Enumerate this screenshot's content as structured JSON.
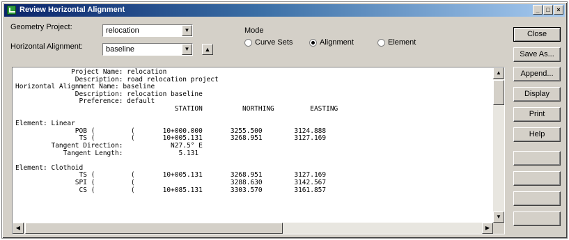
{
  "window": {
    "title": "Review Horizontal Alignment",
    "controls": {
      "minimize": "_",
      "maximize": "□",
      "close": "×"
    }
  },
  "form": {
    "geometry_project_label": "Geometry Project:",
    "geometry_project_value": "relocation",
    "horizontal_alignment_label": "Horizontal Alignment:",
    "horizontal_alignment_value": "baseline",
    "mode_label": "Mode",
    "mode_options": [
      {
        "label": "Curve Sets",
        "selected": false
      },
      {
        "label": "Alignment",
        "selected": true
      },
      {
        "label": "Element",
        "selected": false
      }
    ]
  },
  "report": {
    "lines": [
      "              Project Name: relocation",
      "               Description: road relocation project",
      "Horizontal Alignment Name: baseline",
      "               Description: relocation baseline",
      "                Preference: default",
      "                                        STATION          NORTHING         EASTING",
      "",
      "Element: Linear",
      "               POB (         (       10+000.000       3255.500        3124.888",
      "                TS (         (       10+005.131       3268.951        3127.169",
      "         Tangent Direction:            N27.5° E",
      "            Tangent Length:              5.131",
      "",
      "Element: Clothoid",
      "                TS (         (       10+005.131       3268.951        3127.169",
      "               SPI (         (                        3288.630        3142.567",
      "                CS (         (       10+085.131       3303.570        3161.857"
    ]
  },
  "buttons": [
    {
      "label": "Close",
      "enabled": true,
      "default": true
    },
    {
      "label": "Save As...",
      "enabled": true
    },
    {
      "label": "Append...",
      "enabled": true
    },
    {
      "label": "Display",
      "enabled": true
    },
    {
      "label": "Print",
      "enabled": true
    },
    {
      "label": "Help",
      "enabled": true
    },
    {
      "label": "",
      "enabled": false
    },
    {
      "label": "",
      "enabled": false
    },
    {
      "label": "",
      "enabled": false
    },
    {
      "label": "",
      "enabled": false
    },
    {
      "label": "",
      "enabled": false
    }
  ]
}
